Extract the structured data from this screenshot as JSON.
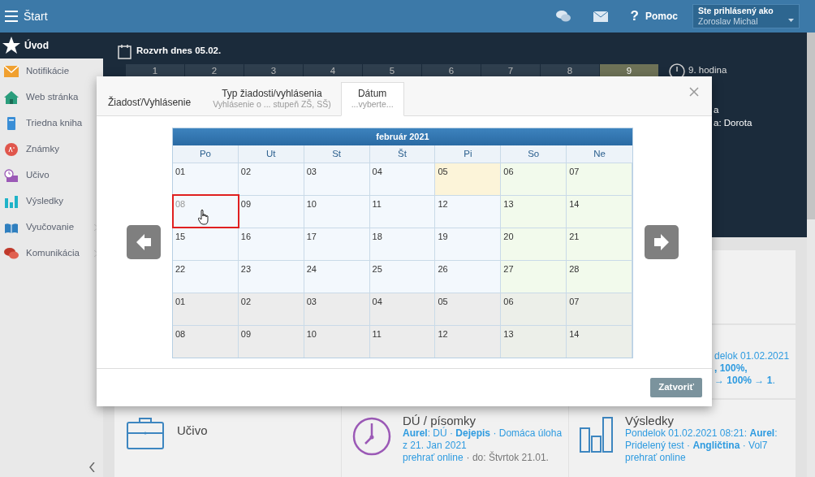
{
  "top_bar": {
    "title": "Štart",
    "help_icon": "?",
    "help": "Pomoc",
    "user_label": "Ste prihlásený ako",
    "user_name": "Zoroslav Michal"
  },
  "sidebar": {
    "items": [
      {
        "label": "Úvod",
        "selected": true,
        "has_submenu": false
      },
      {
        "label": "Notifikácie",
        "selected": false,
        "has_submenu": false
      },
      {
        "label": "Web stránka",
        "selected": false,
        "has_submenu": false
      },
      {
        "label": "Triedna kniha",
        "selected": false,
        "has_submenu": false
      },
      {
        "label": "Známky",
        "selected": false,
        "has_submenu": false
      },
      {
        "label": "Učivo",
        "selected": false,
        "has_submenu": false
      },
      {
        "label": "Výsledky",
        "selected": false,
        "has_submenu": false
      },
      {
        "label": "Vyučovanie",
        "selected": false,
        "has_submenu": true
      },
      {
        "label": "Komunikácia",
        "selected": false,
        "has_submenu": true
      }
    ]
  },
  "schedule": {
    "title": "Rozvrh dnes 05.02.",
    "periods": [
      {
        "label": "1",
        "selected": false
      },
      {
        "label": "2",
        "selected": false
      },
      {
        "label": "3",
        "selected": false
      },
      {
        "label": "4",
        "selected": false
      },
      {
        "label": "5",
        "selected": false
      },
      {
        "label": "6",
        "selected": false
      },
      {
        "label": "7",
        "selected": false
      },
      {
        "label": "8",
        "selected": false
      },
      {
        "label": "9",
        "selected": true
      }
    ],
    "current": "9. hodina",
    "info_lines": [
      "a",
      "a: Dorota"
    ]
  },
  "cards_row_2": {
    "right_fragments": [
      "delok 01.02.2021",
      "**, 100%,**",
      "→ **100% → 1**."
    ]
  },
  "cards": [
    {
      "kind": "briefcase",
      "title": "Učivo"
    },
    {
      "kind": "clock",
      "title": "DÚ / písomky",
      "text": "**Aurel**: DÚ · **Dejepis** · Domáca úloha z 21. Jan 2021",
      "link": "prehrať online",
      "meta": "· do: Štvrtok 21.01."
    },
    {
      "kind": "bars",
      "title": "Výsledky",
      "text": "Pondelok 01.02.2021 08:21: **Aurel**: Pridelený test · **Angličtina** · Vol7",
      "link": "prehrať online"
    }
  ],
  "modal": {
    "tabs": [
      {
        "label": "Žiadosť/Vyhlásenie",
        "selected": false
      },
      {
        "label": "Typ žiadosti/vyhlásenia",
        "subtitle": "Vyhlásenie o ... stupeň ZŠ, SŠ)",
        "selected": false
      },
      {
        "label": "Dátum",
        "subtitle": "...vyberte...",
        "selected": true
      }
    ],
    "calendar": {
      "month": "február 2021",
      "weekdays": [
        "Po",
        "Ut",
        "St",
        "Št",
        "Pi",
        "So",
        "Ne"
      ],
      "weeks": [
        [
          {
            "day": "01",
            "kind": "current",
            "today": false,
            "selected": false
          },
          {
            "day": "02",
            "kind": "current",
            "today": false,
            "selected": false
          },
          {
            "day": "03",
            "kind": "current",
            "today": false,
            "selected": false
          },
          {
            "day": "04",
            "kind": "current",
            "today": false,
            "selected": false
          },
          {
            "day": "05",
            "kind": "current",
            "today": true,
            "selected": false
          },
          {
            "day": "06",
            "kind": "current",
            "today": false,
            "selected": false
          },
          {
            "day": "07",
            "kind": "current",
            "today": false,
            "selected": false
          }
        ],
        [
          {
            "day": "08",
            "kind": "current",
            "today": false,
            "selected": true
          },
          {
            "day": "09",
            "kind": "current",
            "today": false,
            "selected": false
          },
          {
            "day": "10",
            "kind": "current",
            "today": false,
            "selected": false
          },
          {
            "day": "11",
            "kind": "current",
            "today": false,
            "selected": false
          },
          {
            "day": "12",
            "kind": "current",
            "today": false,
            "selected": false
          },
          {
            "day": "13",
            "kind": "current",
            "today": false,
            "selected": false
          },
          {
            "day": "14",
            "kind": "current",
            "today": false,
            "selected": false
          }
        ],
        [
          {
            "day": "15",
            "kind": "current",
            "today": false,
            "selected": false
          },
          {
            "day": "16",
            "kind": "current",
            "today": false,
            "selected": false
          },
          {
            "day": "17",
            "kind": "current",
            "today": false,
            "selected": false
          },
          {
            "day": "18",
            "kind": "current",
            "today": false,
            "selected": false
          },
          {
            "day": "19",
            "kind": "current",
            "today": false,
            "selected": false
          },
          {
            "day": "20",
            "kind": "current",
            "today": false,
            "selected": false
          },
          {
            "day": "21",
            "kind": "current",
            "today": false,
            "selected": false
          }
        ],
        [
          {
            "day": "22",
            "kind": "current",
            "today": false,
            "selected": false
          },
          {
            "day": "23",
            "kind": "current",
            "today": false,
            "selected": false
          },
          {
            "day": "24",
            "kind": "current",
            "today": false,
            "selected": false
          },
          {
            "day": "25",
            "kind": "current",
            "today": false,
            "selected": false
          },
          {
            "day": "26",
            "kind": "current",
            "today": false,
            "selected": false
          },
          {
            "day": "27",
            "kind": "current",
            "today": false,
            "selected": false
          },
          {
            "day": "28",
            "kind": "current",
            "today": false,
            "selected": false
          }
        ],
        [
          {
            "day": "01",
            "kind": "next",
            "today": false,
            "selected": false
          },
          {
            "day": "02",
            "kind": "next",
            "today": false,
            "selected": false
          },
          {
            "day": "03",
            "kind": "next",
            "today": false,
            "selected": false
          },
          {
            "day": "04",
            "kind": "next",
            "today": false,
            "selected": false
          },
          {
            "day": "05",
            "kind": "next",
            "today": false,
            "selected": false
          },
          {
            "day": "06",
            "kind": "next",
            "today": false,
            "selected": false
          },
          {
            "day": "07",
            "kind": "next",
            "today": false,
            "selected": false
          }
        ],
        [
          {
            "day": "08",
            "kind": "next",
            "today": false,
            "selected": false
          },
          {
            "day": "09",
            "kind": "next",
            "today": false,
            "selected": false
          },
          {
            "day": "10",
            "kind": "next",
            "today": false,
            "selected": false
          },
          {
            "day": "11",
            "kind": "next",
            "today": false,
            "selected": false
          },
          {
            "day": "12",
            "kind": "next",
            "today": false,
            "selected": false
          },
          {
            "day": "13",
            "kind": "next",
            "today": false,
            "selected": false
          },
          {
            "day": "14",
            "kind": "next",
            "today": false,
            "selected": false
          }
        ]
      ]
    },
    "close_button": "Zatvoriť"
  }
}
